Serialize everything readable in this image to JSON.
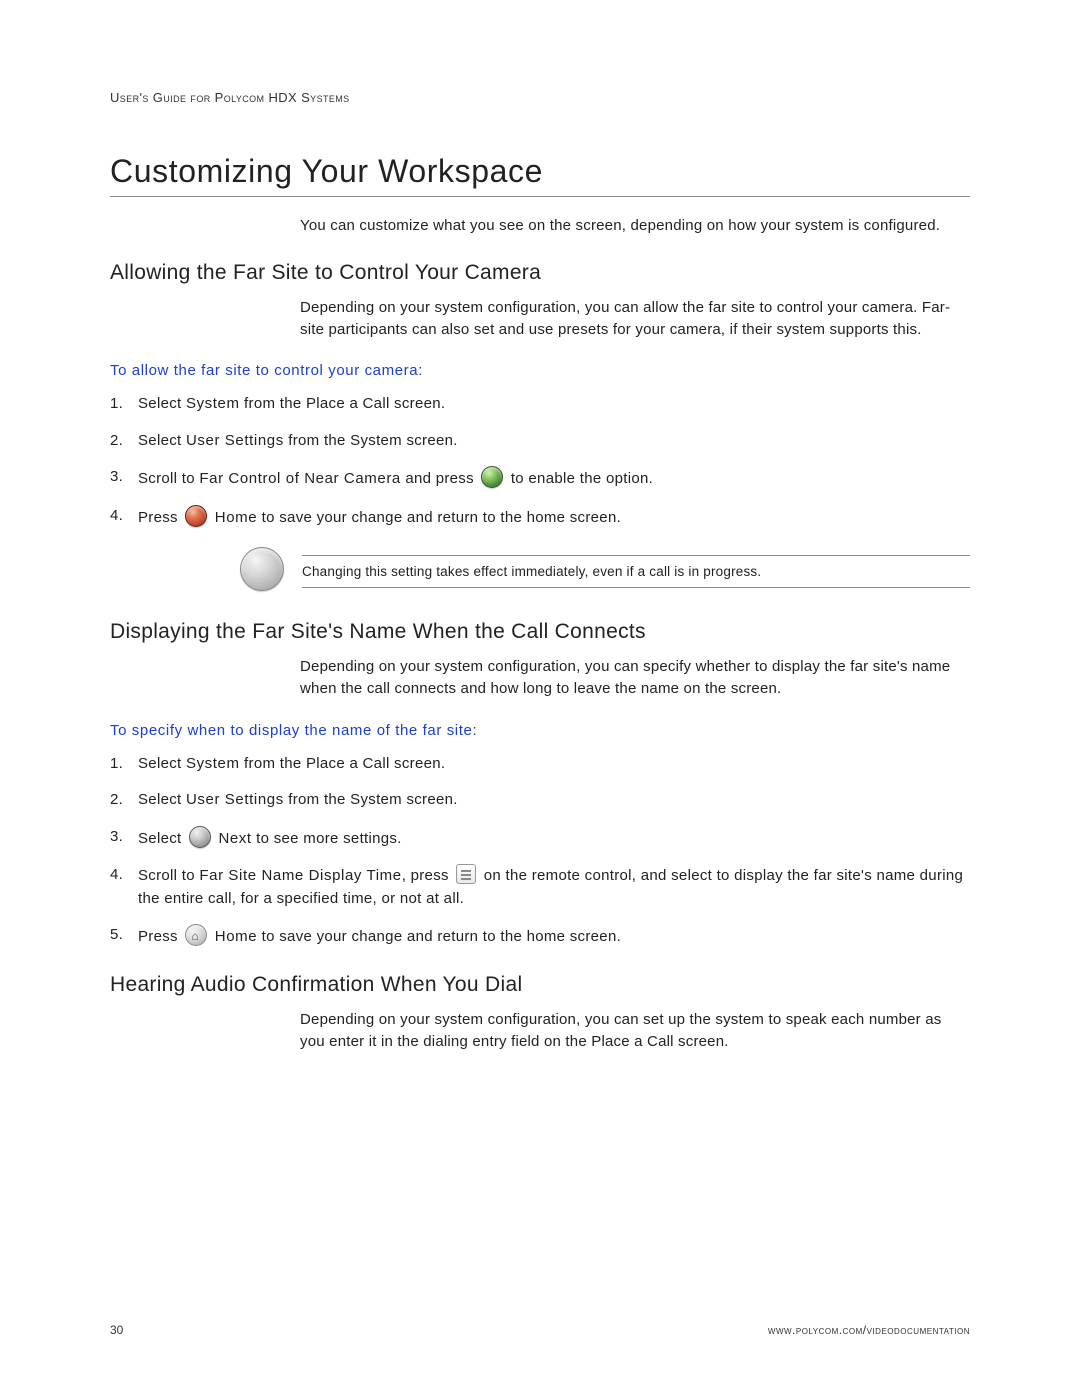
{
  "header": {
    "running": "User's Guide for Polycom HDX Systems"
  },
  "h1": "Customizing Your Workspace",
  "intro": "You can customize what you see on the screen, depending on how your system is configured.",
  "sec1": {
    "title": "Allowing the Far Site to Control Your Camera",
    "para": "Depending on your system configuration, you can allow the far site to control your camera. Far-site participants can also set and use presets for your camera, if their system supports this.",
    "task": "To allow the far site to control your camera:",
    "steps": {
      "s1_a": "Select ",
      "s1_b": "System",
      "s1_c": " from the Place a Call screen.",
      "s2_a": "Select ",
      "s2_b": "User Settings",
      "s2_c": " from the System screen.",
      "s3_a": "Scroll to ",
      "s3_b": "Far Control of Near Camera",
      "s3_c": " and press ",
      "s3_d": " to enable the option.",
      "s4_a": "Press ",
      "s4_b": "Home",
      "s4_c": " to save your change and return to the home screen."
    },
    "note": "Changing this setting takes effect immediately, even if a call is in progress."
  },
  "sec2": {
    "title": "Displaying the Far Site's Name When the Call Connects",
    "para": "Depending on your system configuration, you can specify whether to display the far site's name when the call connects and how long to leave the name on the screen.",
    "task": "To specify when to display the name of the far site:",
    "steps": {
      "s1_a": "Select ",
      "s1_b": "System",
      "s1_c": " from the Place a Call screen.",
      "s2_a": "Select ",
      "s2_b": "User Settings",
      "s2_c": " from the System screen.",
      "s3_a": "Select ",
      "s3_b": "Next",
      "s3_c": " to see more settings.",
      "s4_a": "Scroll to ",
      "s4_b": "Far Site Name Display Time",
      "s4_c": ", press ",
      "s4_d": " on the remote control, and select to display the far site's name during the entire call, for a specified time, or not at all.",
      "s5_a": "Press ",
      "s5_b": "Home",
      "s5_c": " to save your change and return to the home screen."
    }
  },
  "sec3": {
    "title": "Hearing Audio Confirmation When You Dial",
    "para": "Depending on your system configuration, you can set up the system to speak each number as you enter it in the dialing entry field on the Place a Call screen."
  },
  "footer": {
    "page": "30",
    "url": "www.polycom.com/videodocumentation"
  }
}
